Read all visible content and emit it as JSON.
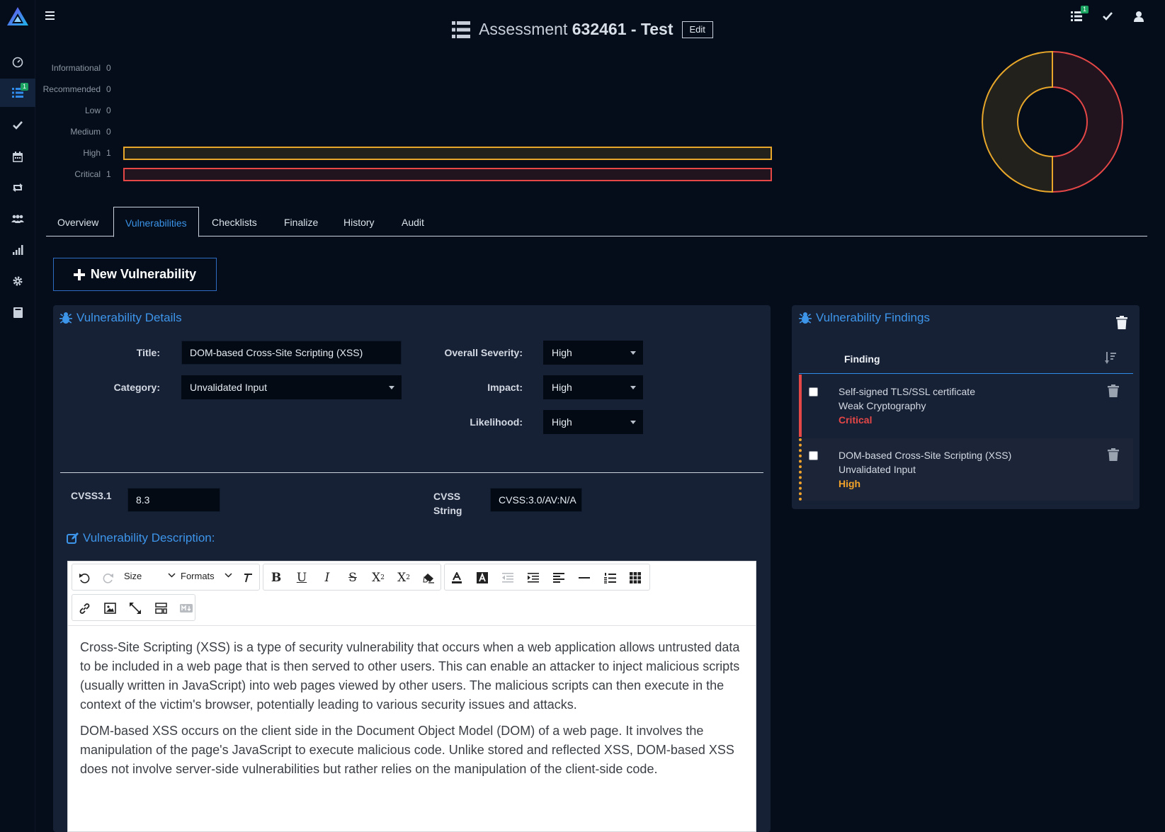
{
  "header": {
    "title_prefix": "Assessment",
    "title_main": "632461 - Test",
    "edit_label": "Edit"
  },
  "nav": {
    "sidebar_icons": [
      "logo-icon",
      "dashboard-icon",
      "assessments-icon",
      "checklist-icon",
      "calendar-icon",
      "retest-icon",
      "teams-icon",
      "metrics-icon",
      "settings-icon",
      "book-icon"
    ],
    "assessments_badge": "1",
    "topbar_badge": "1"
  },
  "severity": {
    "rows": [
      {
        "label": "Informational",
        "count": 0
      },
      {
        "label": "Recommended",
        "count": 0
      },
      {
        "label": "Low",
        "count": 0
      },
      {
        "label": "Medium",
        "count": 0
      },
      {
        "label": "High",
        "count": 1
      },
      {
        "label": "Critical",
        "count": 1
      }
    ],
    "colors": {
      "High": "#e8a72a",
      "Critical": "#e54747"
    }
  },
  "tabs": [
    "Overview",
    "Vulnerabilities",
    "Checklists",
    "Finalize",
    "History",
    "Audit"
  ],
  "active_tab": "Vulnerabilities",
  "new_vuln_label": "New Vulnerability",
  "details": {
    "panel_title": "Vulnerability Details",
    "title_label": "Title:",
    "title_value": "DOM-based Cross-Site Scripting (XSS)",
    "category_label": "Category:",
    "category_value": "Unvalidated Input",
    "overall_label": "Overall Severity:",
    "overall_value": "High",
    "impact_label": "Impact:",
    "impact_value": "High",
    "likelihood_label": "Likelihood:",
    "likelihood_value": "High",
    "cvss_label": "CVSS3.1",
    "cvss_value": "8.3",
    "cvss_string_label_1": "CVSS",
    "cvss_string_label_2": "String",
    "cvss_string_value": "CVSS:3.0/AV:N/A"
  },
  "description": {
    "title": "Vulnerability Description:",
    "toolbar": {
      "size_label": "Size",
      "formats_label": "Formats"
    },
    "paragraphs": [
      "Cross-Site Scripting (XSS) is a type of security vulnerability that occurs when a web application allows untrusted data to be included in a web page that is then served to other users. This can enable an attacker to inject malicious scripts (usually written in JavaScript) into web pages viewed by other users. The malicious scripts can then execute in the context of the victim's browser, potentially leading to various security issues and attacks.",
      "DOM-based XSS occurs on the client side in the Document Object Model (DOM) of a web page. It involves the manipulation of the page's JavaScript to execute malicious code. Unlike stored and reflected XSS, DOM-based XSS does not involve server-side vulnerabilities but rather relies on the manipulation of the client-side code."
    ]
  },
  "findings": {
    "panel_title": "Vulnerability Findings",
    "column_header": "Finding",
    "items": [
      {
        "title": "Self-signed TLS/SSL certificate",
        "category": "Weak Cryptography",
        "severity": "Critical",
        "color": "#e54747"
      },
      {
        "title": "DOM-based Cross-Site Scripting (XSS)",
        "category": "Unvalidated Input",
        "severity": "High",
        "color": "#f0a22a"
      }
    ]
  },
  "donut": {
    "segments": [
      {
        "label": "Critical",
        "value": 1,
        "color": "#e54747"
      },
      {
        "label": "High",
        "value": 1,
        "color": "#e8a72a"
      }
    ]
  }
}
